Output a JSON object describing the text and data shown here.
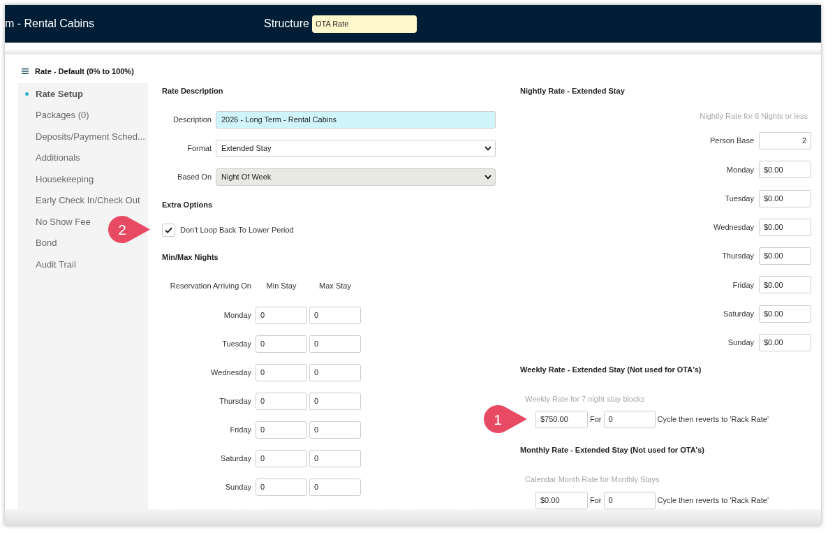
{
  "header": {
    "title": "m - Rental Cabins",
    "structure": {
      "label": "Structure",
      "value": "OTA Rate"
    }
  },
  "sidebar": {
    "title": "Rate - Default (0% to 100%)",
    "items": [
      {
        "label": "Rate Setup",
        "selected": true
      },
      {
        "label": "Packages (0)",
        "selected": false
      },
      {
        "label": "Deposits/Payment Sched...",
        "selected": false
      },
      {
        "label": "Additionals",
        "selected": false
      },
      {
        "label": "Housekeeping",
        "selected": false
      },
      {
        "label": "Early Check In/Check Out",
        "selected": false
      },
      {
        "label": "No Show Fee",
        "selected": false
      },
      {
        "label": "Bond",
        "selected": false
      },
      {
        "label": "Audit Trail",
        "selected": false
      }
    ]
  },
  "rate_description": {
    "heading": "Rate Description",
    "fields": [
      {
        "kind": "text",
        "label": "Description",
        "value": "2026 - Long Term - Rental Cabins",
        "highlighted": true,
        "disabled": false
      },
      {
        "kind": "select",
        "label": "Format",
        "value": "Extended Stay",
        "highlighted": false,
        "disabled": false
      },
      {
        "kind": "select",
        "label": "Based On",
        "value": "Night Of Week",
        "highlighted": false,
        "disabled": true
      }
    ]
  },
  "extra_options": {
    "heading": "Extra Options",
    "options": [
      {
        "label": "Don't Loop Back To Lower Period",
        "checked": true,
        "callout": "2"
      }
    ]
  },
  "min_max_nights": {
    "heading": "Min/Max Nights",
    "columns": [
      "Reservation Arriving On",
      "Min Stay",
      "Max Stay"
    ],
    "rows": [
      {
        "day": "Monday",
        "min_stay": "0",
        "max_stay": "0"
      },
      {
        "day": "Tuesday",
        "min_stay": "0",
        "max_stay": "0"
      },
      {
        "day": "Wednesday",
        "min_stay": "0",
        "max_stay": "0"
      },
      {
        "day": "Thursday",
        "min_stay": "0",
        "max_stay": "0"
      },
      {
        "day": "Friday",
        "min_stay": "0",
        "max_stay": "0"
      },
      {
        "day": "Saturday",
        "min_stay": "0",
        "max_stay": "0"
      },
      {
        "day": "Sunday",
        "min_stay": "0",
        "max_stay": "0"
      }
    ]
  },
  "nightly_rate": {
    "heading": "Nightly Rate - Extended Stay",
    "note": "Nightly Rate for 6 Nights or less",
    "person_base": {
      "label": "Person Base",
      "value": "2"
    },
    "rows": [
      {
        "day": "Monday",
        "rate": "$0.00"
      },
      {
        "day": "Tuesday",
        "rate": "$0.00"
      },
      {
        "day": "Wednesday",
        "rate": "$0.00"
      },
      {
        "day": "Thursday",
        "rate": "$0.00"
      },
      {
        "day": "Friday",
        "rate": "$0.00"
      },
      {
        "day": "Saturday",
        "rate": "$0.00"
      },
      {
        "day": "Sunday",
        "rate": "$0.00"
      }
    ]
  },
  "weekly_rate": {
    "heading": "Weekly Rate - Extended Stay (Not used for OTA's)",
    "note": "Weekly Rate for 7 night stay blocks",
    "rate": "$750.00",
    "for_label": "For",
    "cycles": "0",
    "suffix": "Cycle then reverts to 'Rack Rate'",
    "callout": "1"
  },
  "monthly_rate": {
    "heading": "Monthly Rate - Extended Stay (Not used for OTA's)",
    "note": "Calendar Month Rate for Monthly Stays",
    "rate": "$0.00",
    "for_label": "For",
    "cycles": "0",
    "suffix": "Cycle then reverts to 'Rack Rate'"
  }
}
